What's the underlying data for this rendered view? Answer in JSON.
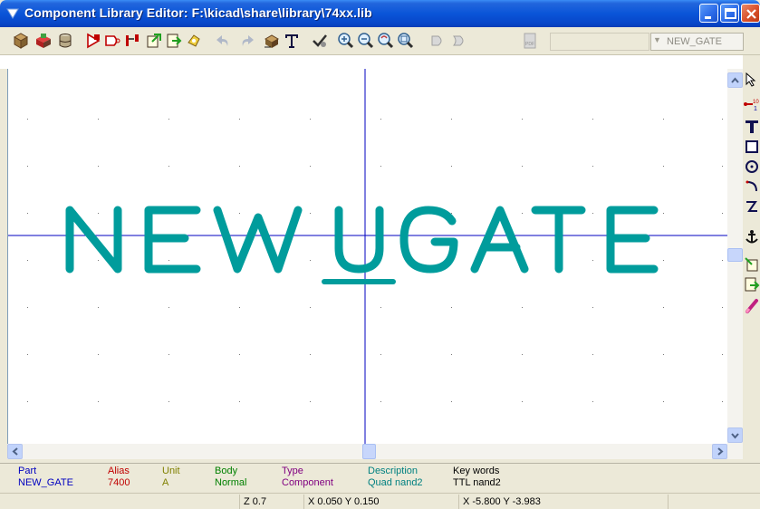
{
  "window": {
    "title": "Component Library Editor: F:\\kicad\\share\\library\\74xx.lib"
  },
  "toolbar": {
    "icons": [
      "new-component-icon",
      "load-component-icon",
      "library-save-icon",
      "edit-component-icon",
      "test-component-icon",
      "pin-table-icon",
      "import-icon",
      "export-icon",
      "create-component-icon",
      "undo-icon",
      "redo-icon",
      "component-properties-icon",
      "text-icon",
      "check-erc-icon",
      "zoom-in-icon",
      "zoom-out-icon",
      "zoom-redraw-icon",
      "zoom-fit-icon",
      "de-morgan-normal-icon",
      "de-morgan-convert-icon",
      "pdf-datasheet-icon"
    ],
    "part_select_value": "NEW_GATE"
  },
  "canvas": {
    "component_text": "NEWUGATE",
    "text_color": "#009C9C",
    "axis_color": "#0000C0"
  },
  "info": {
    "columns": [
      {
        "label": "Part",
        "value": "NEW_GATE",
        "label_color": "#0000C0",
        "value_color": "#0000C0"
      },
      {
        "label": "Alias",
        "value": "7400",
        "label_color": "#C00000",
        "value_color": "#C00000"
      },
      {
        "label": "Unit",
        "value": "A",
        "label_color": "#808000",
        "value_color": "#808000"
      },
      {
        "label": "Body",
        "value": "Normal",
        "label_color": "#008000",
        "value_color": "#008000"
      },
      {
        "label": "Type",
        "value": "Component",
        "label_color": "#800080",
        "value_color": "#800080"
      },
      {
        "label": "Description",
        "value": "Quad nand2",
        "label_color": "#008080",
        "value_color": "#008080"
      },
      {
        "label": "Key words",
        "value": "TTL nand2",
        "label_color": "#000000",
        "value_color": "#000000"
      }
    ]
  },
  "status": {
    "zoom": "Z 0.7",
    "abs_coords": "X 0.050  Y 0.150",
    "rel_coords": "X -5.800  Y -3.983"
  },
  "right_toolbar": {
    "icons": [
      "select-arrow-icon",
      "add-pin-icon",
      "add-text-icon",
      "add-rectangle-icon",
      "add-circle-icon",
      "add-arc-icon",
      "add-polyline-icon",
      "set-anchor-icon",
      "import-drawing-icon",
      "export-drawing-icon",
      "delete-icon"
    ]
  }
}
